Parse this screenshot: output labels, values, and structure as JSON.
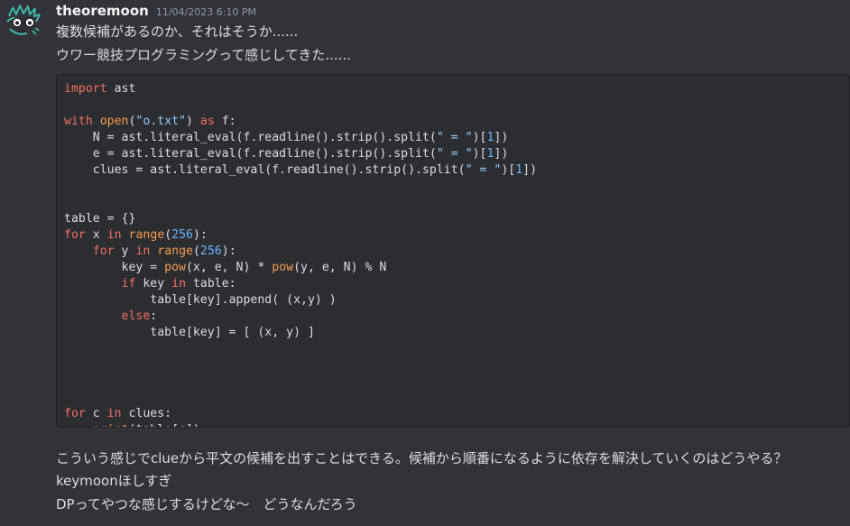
{
  "message": {
    "username": "theoremoon",
    "timestamp": "11/04/2023 6:10 PM",
    "lines_before": [
      "複数候補があるのか、それはそうか......",
      "ウワー競技プログラミングって感じしてきた......"
    ],
    "code": [
      [
        [
          "kw",
          "import"
        ],
        [
          "tx",
          " ast"
        ]
      ],
      [],
      [
        [
          "kw",
          "with"
        ],
        [
          "tx",
          " "
        ],
        [
          "fn",
          "open"
        ],
        [
          "tx",
          "("
        ],
        [
          "str",
          "\"o.txt\""
        ],
        [
          "tx",
          ") "
        ],
        [
          "kw",
          "as"
        ],
        [
          "tx",
          " f:"
        ]
      ],
      [
        [
          "tx",
          "    N = ast.literal_eval(f.readline().strip().split("
        ],
        [
          "str",
          "\" = \""
        ],
        [
          "tx",
          ")["
        ],
        [
          "num",
          "1"
        ],
        [
          "tx",
          "])"
        ]
      ],
      [
        [
          "tx",
          "    e = ast.literal_eval(f.readline().strip().split("
        ],
        [
          "str",
          "\" = \""
        ],
        [
          "tx",
          ")["
        ],
        [
          "num",
          "1"
        ],
        [
          "tx",
          "])"
        ]
      ],
      [
        [
          "tx",
          "    clues = ast.literal_eval(f.readline().strip().split("
        ],
        [
          "str",
          "\" = \""
        ],
        [
          "tx",
          ")["
        ],
        [
          "num",
          "1"
        ],
        [
          "tx",
          "])"
        ]
      ],
      [],
      [],
      [
        [
          "tx",
          "table = {}"
        ]
      ],
      [
        [
          "kw",
          "for"
        ],
        [
          "tx",
          " x "
        ],
        [
          "kw",
          "in"
        ],
        [
          "tx",
          " "
        ],
        [
          "fn",
          "range"
        ],
        [
          "tx",
          "("
        ],
        [
          "num",
          "256"
        ],
        [
          "tx",
          "):"
        ]
      ],
      [
        [
          "tx",
          "    "
        ],
        [
          "kw",
          "for"
        ],
        [
          "tx",
          " y "
        ],
        [
          "kw",
          "in"
        ],
        [
          "tx",
          " "
        ],
        [
          "fn",
          "range"
        ],
        [
          "tx",
          "("
        ],
        [
          "num",
          "256"
        ],
        [
          "tx",
          "):"
        ]
      ],
      [
        [
          "tx",
          "        key = "
        ],
        [
          "fn",
          "pow"
        ],
        [
          "tx",
          "(x, e, N) * "
        ],
        [
          "fn",
          "pow"
        ],
        [
          "tx",
          "(y, e, N) % N"
        ]
      ],
      [
        [
          "tx",
          "        "
        ],
        [
          "kw",
          "if"
        ],
        [
          "tx",
          " key "
        ],
        [
          "kw",
          "in"
        ],
        [
          "tx",
          " table:"
        ]
      ],
      [
        [
          "tx",
          "            table[key].append( (x,y) )"
        ]
      ],
      [
        [
          "tx",
          "        "
        ],
        [
          "kw",
          "else"
        ],
        [
          "tx",
          ":"
        ]
      ],
      [
        [
          "tx",
          "            table[key] = [ (x, y) ]"
        ]
      ],
      [],
      [],
      [],
      [],
      [
        [
          "kw",
          "for"
        ],
        [
          "tx",
          " c "
        ],
        [
          "kw",
          "in"
        ],
        [
          "tx",
          " clues:"
        ]
      ],
      [
        [
          "tx",
          "    "
        ],
        [
          "fn",
          "print"
        ],
        [
          "tx",
          "(table[c])"
        ]
      ]
    ],
    "lines_after": [
      "こういう感じでclueから平文の候補を出すことはできる。候補から順番になるように依存を解決していくのはどうやる？",
      "keymoonほしすぎ",
      "DPってやつな感じするけどな〜　どうなんだろう"
    ]
  },
  "colors": {
    "background": "#313338",
    "code_background": "#2b2d31",
    "keyword": "#f47067",
    "builtin": "#f69d50",
    "string": "#96d0ff",
    "number": "#6cb6ff"
  },
  "icons": {
    "avatar": "cartoon-face-avatar-icon"
  }
}
